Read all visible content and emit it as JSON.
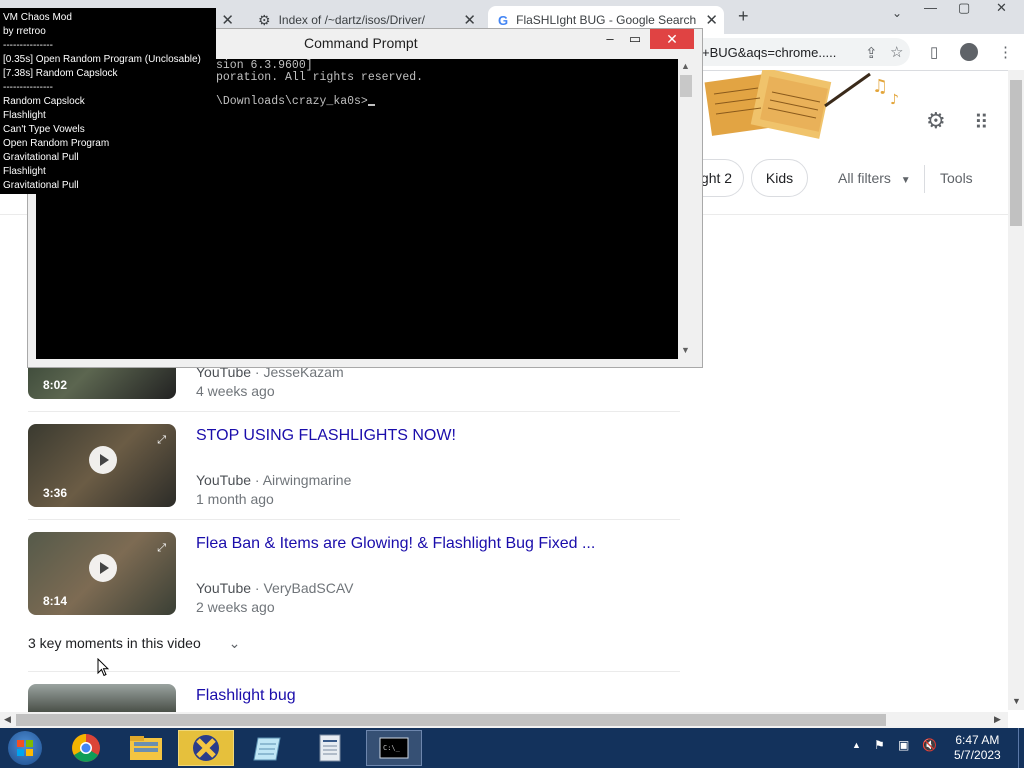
{
  "chrome": {
    "tabs": [
      {
        "title": "Index of /~dartz/isos/Driver/"
      },
      {
        "title": "FlaSHLIght BUG - Google Search"
      }
    ],
    "url_fragment": "+BUG&aqs=chrome....."
  },
  "overlay": {
    "lines": [
      "VM Chaos Mod",
      "by rretroo",
      "---------------",
      "[0.35s] Open Random Program (Unclosable)",
      "[7.38s] Random Capslock",
      "---------------",
      "Random Capslock",
      "Flashlight",
      "Can't Type Vowels",
      "Open Random Program",
      "Gravitational Pull",
      "Flashlight",
      "Gravitational Pull"
    ]
  },
  "cmd": {
    "title": "Command Prompt",
    "lines": [
      "sion 6.3.9600]",
      "poration. All rights reserved.",
      "",
      "\\Downloads\\crazy_ka0s>"
    ]
  },
  "filters": {
    "chip_partial": "ght 2",
    "kids": "Kids",
    "all_filters": "All filters",
    "tools": "Tools"
  },
  "results": [
    {
      "title": "",
      "source": "YouTube",
      "channel": "JesseKazam",
      "date": "4 weeks ago",
      "duration": "8:02"
    },
    {
      "title": "STOP USING FLASHLIGHTS NOW!",
      "source": "YouTube",
      "channel": "Airwingmarine",
      "date": "1 month ago",
      "duration": "3:36"
    },
    {
      "title": "Flea Ban & Items are Glowing! & Flashlight Bug Fixed ...",
      "source": "YouTube",
      "channel": "VeryBadSCAV",
      "date": "2 weeks ago",
      "duration": "8:14"
    },
    {
      "title": "Flashlight bug",
      "source": "",
      "channel": "",
      "date": "",
      "duration": ""
    }
  ],
  "key_moments": "3 key moments in this video",
  "taskbar": {
    "clock_time": "6:47 AM",
    "clock_date": "5/7/2023"
  },
  "colors": {
    "link": "#1a0dab",
    "taskbar": "#13325c",
    "cmd_close": "#e04343"
  }
}
